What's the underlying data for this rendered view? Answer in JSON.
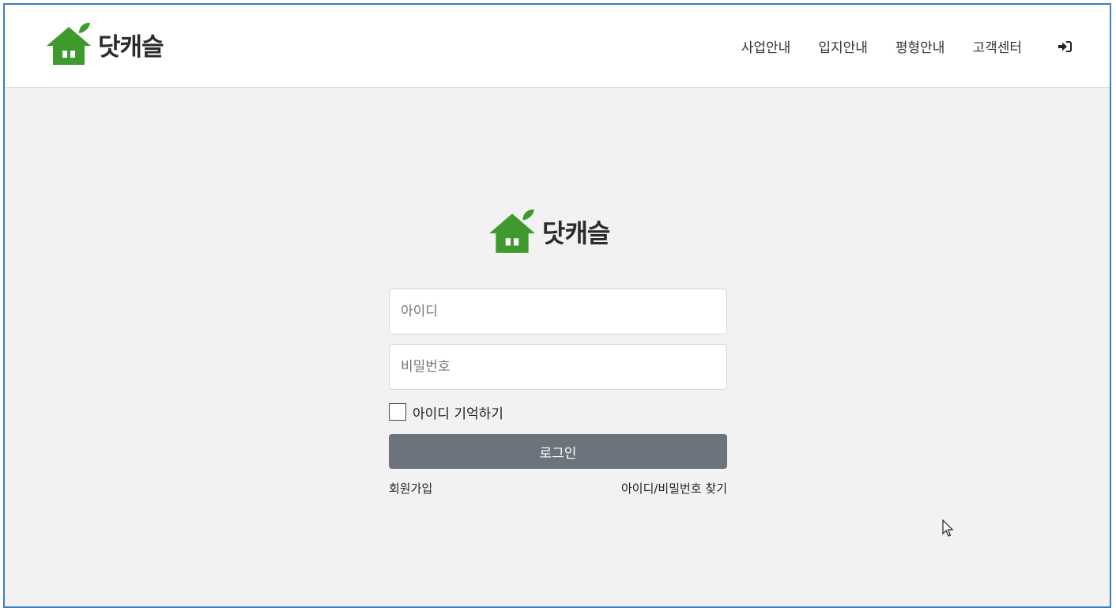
{
  "brand": {
    "name": "닷캐슬",
    "color": "#3f9a2e"
  },
  "nav": {
    "items": [
      "사업안내",
      "입지안내",
      "평형안내",
      "고객센터"
    ],
    "login_icon": "sign-in-icon"
  },
  "login_form": {
    "id_placeholder": "아이디",
    "password_placeholder": "비밀번호",
    "remember_label": "아이디 기억하기",
    "submit_label": "로그인",
    "signup_link": "회원가입",
    "find_link": "아이디/비밀번호 찾기"
  },
  "colors": {
    "button": "#6c737c",
    "background": "#f2f2f2",
    "frame_border": "#3a7fc1"
  }
}
